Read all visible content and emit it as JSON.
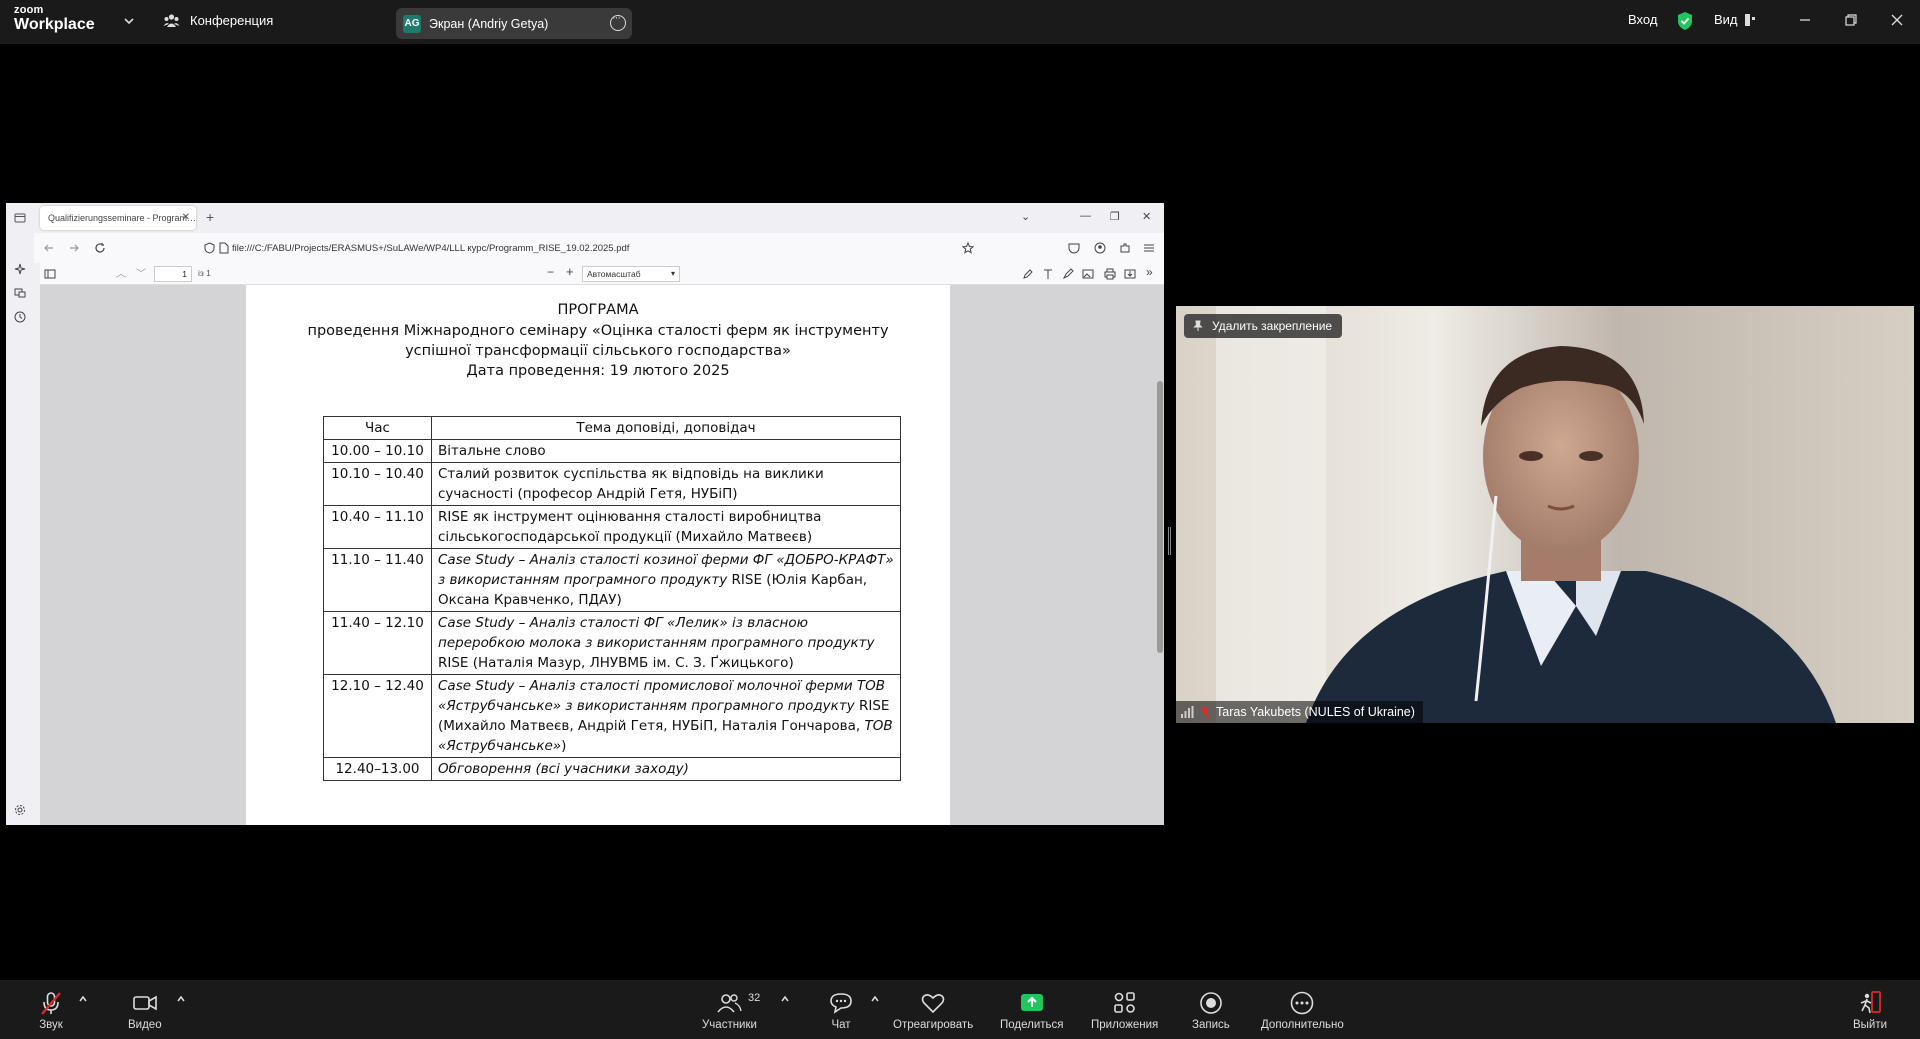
{
  "zoom_top": {
    "logo_small": "zoom",
    "logo_big": "Workplace",
    "meeting_label": "Конференция",
    "screen_share_initials": "AG",
    "screen_share_label": "Экран (Andriy Getya)",
    "signin": "Вход",
    "view": "Вид",
    "security_color": "#23c55e"
  },
  "browser": {
    "tab_title": "Qualifizierungsseminare - Program…",
    "url": "file:///C:/FABU/Projects/ERASMUS+/SuLAWe/WP4/LLL курс/Programm_RISE_19.02.2025.pdf",
    "page_number": "1",
    "page_of": "із 1",
    "zoom_option": "Автомасштаб"
  },
  "document": {
    "title": "ПРОГРАМА",
    "subtitle_line1": "проведення Міжнародного семінару «Оцінка сталості ферм як інструменту",
    "subtitle_line2": "успішної трансформації сільського господарства»",
    "date_line": "Дата проведення: 19 лютого 2025",
    "table_headers": [
      "Час",
      "Тема доповіді, доповідач"
    ],
    "rows": [
      {
        "time": "10.00 – 10.10",
        "topic": "Вітальне слово"
      },
      {
        "time": "10.10 – 10.40",
        "topic": "Сталий розвиток суспільства як відповідь на виклики сучасності (професор Андрій Гетя, НУБіП)"
      },
      {
        "time": "10.40 – 11.10",
        "topic": "RISE як інструмент оцінювання сталості виробництва сільськогосподарської продукції (Михайло Матвеєв)"
      },
      {
        "time": "11.10 – 11.40",
        "topic_italic": "Case Study – Аналіз сталості козиної ферми ФГ «ДОБРО-КРАФТ» з використанням програмного продукту",
        "topic_normal": " RISE (Юлія Карбан, Оксана Кравченко, ПДАУ)"
      },
      {
        "time": "11.40 – 12.10",
        "topic_italic": "Case Study – Аналіз сталості ФГ «Лелик» із власною переробкою молока з використанням програмного продукту",
        "topic_normal": " RISE (Наталія Мазур, ЛНУВМБ ім. С. З. Ґжицького)"
      },
      {
        "time": "12.10 – 12.40",
        "topic_italic": "Case Study – Аналіз сталості промислової молочної ферми ТОВ «Яструбчанське» з використанням програмного продукту",
        "topic_normal": " RISE (Михайло Матвеєв, Андрій Гетя, НУБіП, Наталія Гончарова, ",
        "topic_italic2": "ТОВ «Яструбчанське»",
        "topic_normal2": ")"
      },
      {
        "time": "12.40–13.00",
        "topic_italic": "Обговорення (всі учасники заходу)"
      }
    ]
  },
  "video": {
    "unpin_label": "Удалить закрепление",
    "participant_name": "Taras Yakubets (NULES of Ukraine)"
  },
  "bottom": {
    "audio": "Звук",
    "video": "Видео",
    "participants": "Участники",
    "participants_count": "32",
    "chat": "Чат",
    "react": "Отреагировать",
    "share": "Поделиться",
    "apps": "Приложения",
    "record": "Запись",
    "more": "Дополнительно",
    "leave": "Выйти",
    "share_color": "#23c55e",
    "leave_color": "#e02828"
  }
}
